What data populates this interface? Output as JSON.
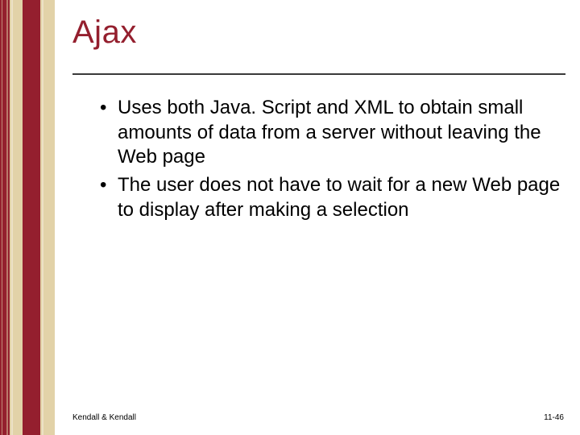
{
  "title": "Ajax",
  "bullets": [
    "Uses both Java. Script and XML to obtain small amounts of data from a server without leaving the Web page",
    "The user does not have to wait for a new Web page to display after making a selection"
  ],
  "footer": {
    "left": "Kendall & Kendall",
    "right": "11-46"
  },
  "colors": {
    "accent": "#941f2e",
    "sidebar": "#e2d2a8"
  }
}
